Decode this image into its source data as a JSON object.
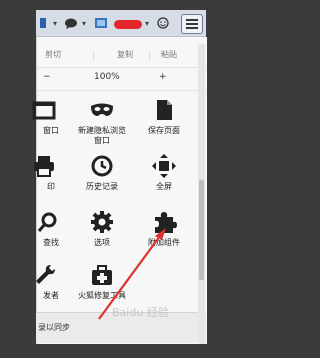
{
  "edit_row": {
    "cut": "剪切",
    "copy": "复制",
    "paste": "粘贴"
  },
  "zoom_row": {
    "minus": "−",
    "level": "100%",
    "plus": "+"
  },
  "menu_items": [
    {
      "label": "窗口",
      "icon": "window-icon"
    },
    {
      "label": "新建隐私浏览\n窗口",
      "icon": "mask-icon"
    },
    {
      "label": "保存页面",
      "icon": "page-icon"
    },
    {
      "label": "印",
      "icon": "printer-icon"
    },
    {
      "label": "历史记录",
      "icon": "clock-icon"
    },
    {
      "label": "全屏",
      "icon": "fullscreen-icon"
    },
    {
      "label": "查找",
      "icon": "search-icon"
    },
    {
      "label": "选项",
      "icon": "gear-icon"
    },
    {
      "label": "附加组件",
      "icon": "puzzle-icon"
    },
    {
      "label": "发者",
      "icon": "wrench-icon"
    },
    {
      "label": "火狐修复工具",
      "icon": "medkit-icon"
    }
  ],
  "bottom": {
    "sync_label": "录以同步"
  },
  "watermark": "Baidu 经验",
  "colors": {
    "arrow": "#e0312f",
    "toolbar": "#d6dde6",
    "panel": "#f7f7f7"
  }
}
